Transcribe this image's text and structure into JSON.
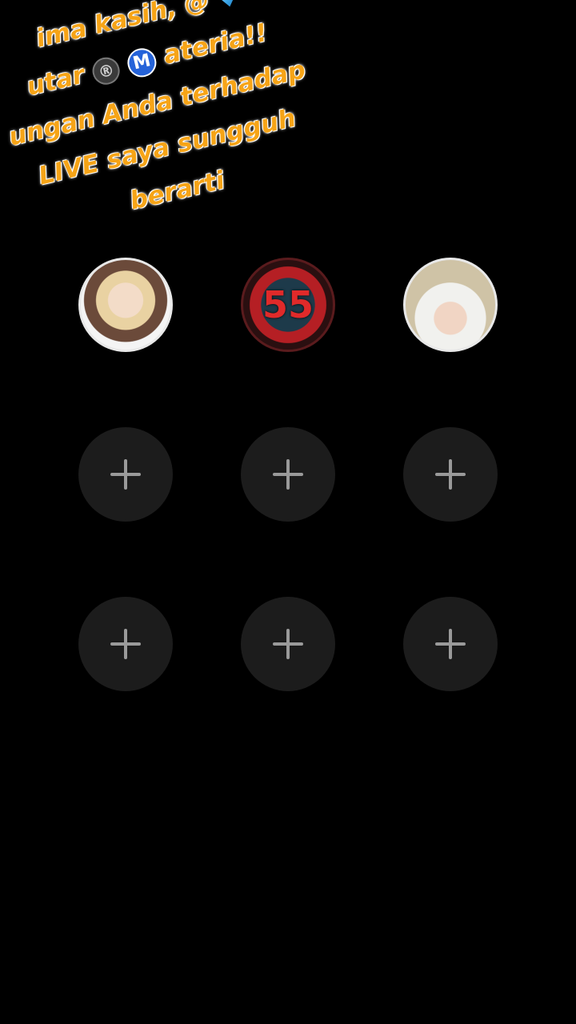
{
  "banner": {
    "lines": [
      "ima kasih, @",
      "utar",
      "ateria!!",
      "ungan Anda terhadap",
      "LIVE saya sungguh",
      "berarti"
    ],
    "badge_r": "®",
    "badge_m": "M"
  },
  "avatars": [
    {
      "label": "",
      "icon": "user-avatar"
    },
    {
      "label": "55",
      "icon": "user-avatar"
    },
    {
      "label": "",
      "icon": "user-avatar"
    }
  ],
  "empty_slots": 6,
  "colors": {
    "background": "#000000",
    "banner_text": "#f6a417",
    "slot_bg": "#1c1c1c",
    "plus": "#9a9a9a"
  }
}
